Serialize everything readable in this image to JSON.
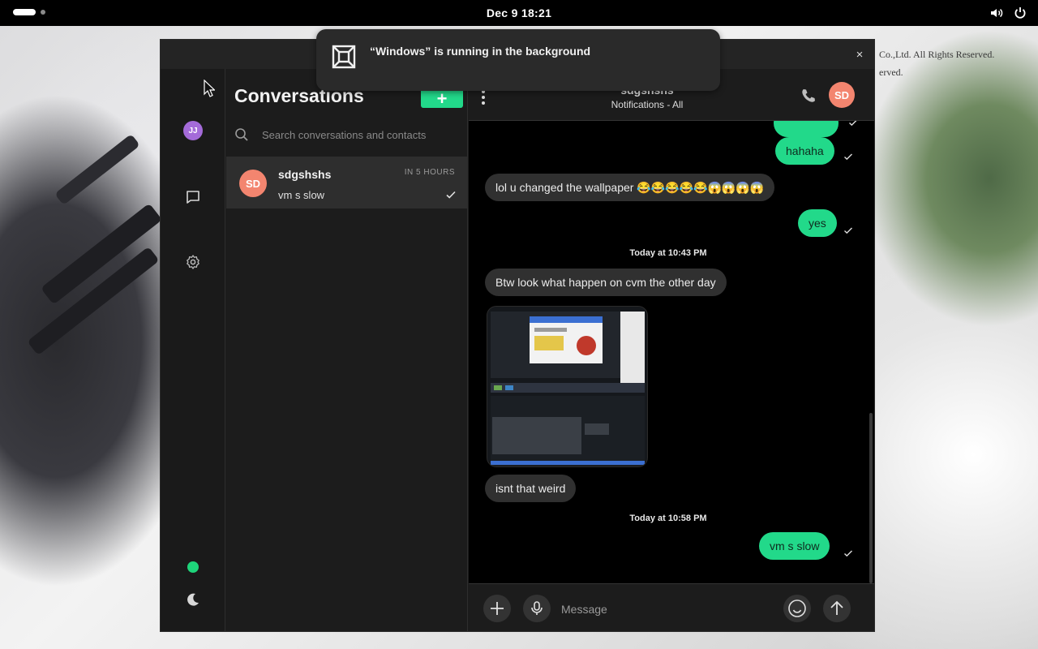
{
  "topbar": {
    "clock": "Dec 9  18:21",
    "icons": [
      "activities-indicator",
      "volume-icon",
      "power-icon"
    ]
  },
  "notification": {
    "text": "“Windows” is running in the background",
    "icon": "app-grid-icon"
  },
  "window": {
    "close_label": "×"
  },
  "rail": {
    "user_initials": "JJ",
    "user_avatar_color": "#a46bd9",
    "items": [
      "chat-icon",
      "settings-icon"
    ],
    "status_color": "#1ed47a",
    "theme_icon": "moon-icon"
  },
  "conversations": {
    "title": "Conversations",
    "new_label": "+",
    "search_placeholder": "Search conversations and contacts",
    "items": [
      {
        "initials": "SD",
        "name": "sdgshshs",
        "time": "IN 5 HOURS",
        "snippet": "vm s slow",
        "avatar_color": "#f3856f"
      }
    ]
  },
  "chat": {
    "name": "sdgshshs",
    "subtitle": "Notifications - All",
    "avatar_initials": "SD",
    "accent": "#22d98a",
    "messages": [
      {
        "dir": "out",
        "text": "hahaha"
      },
      {
        "dir": "in",
        "text": "lol u changed the wallpaper 😂😂😂😂😂😱😱😱😱"
      },
      {
        "dir": "out",
        "text": "yes"
      },
      {
        "dir": "sep",
        "text": "Today at 10:43 PM"
      },
      {
        "dir": "in",
        "text": "Btw look what happen on cvm the other day"
      },
      {
        "dir": "in",
        "image": "screenshot-attachment"
      },
      {
        "dir": "in",
        "text": "isnt that weird"
      },
      {
        "dir": "sep",
        "text": "Today at 10:58 PM"
      },
      {
        "dir": "out",
        "text": "vm s slow"
      }
    ],
    "composer_placeholder": "Message"
  },
  "wallpaper": {
    "text_line1": "Co.,Ltd. All Rights Reserved.",
    "text_line2": "erved."
  }
}
